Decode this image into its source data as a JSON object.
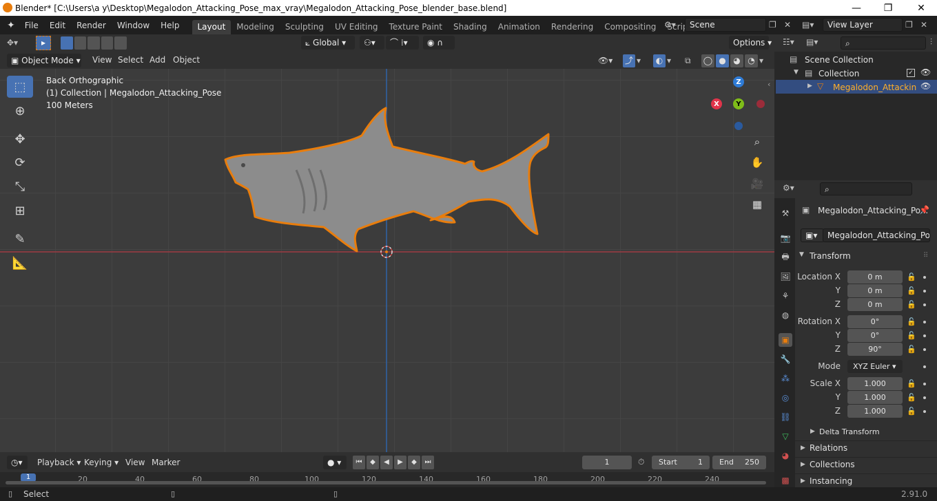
{
  "window": {
    "title": "Blender* [C:\\Users\\a y\\Desktop\\Megalodon_Attacking_Pose_max_vray\\Megalodon_Attacking_Pose_blender_base.blend]"
  },
  "menus": [
    "File",
    "Edit",
    "Render",
    "Window",
    "Help"
  ],
  "workspaces": [
    "Layout",
    "Modeling",
    "Sculpting",
    "UV Editing",
    "Texture Paint",
    "Shading",
    "Animation",
    "Rendering",
    "Compositing",
    "Scripting"
  ],
  "scene": {
    "name": "Scene",
    "view_layer": "View Layer"
  },
  "toolheader": {
    "orientation": "Global",
    "options": "Options"
  },
  "viewport_header": {
    "mode": "Object Mode",
    "menus": [
      "View",
      "Select",
      "Add",
      "Object"
    ]
  },
  "viewport": {
    "view_name": "Back Orthographic",
    "collection_info": "(1) Collection | Megalodon_Attacking_Pose",
    "scale_text": "100 Meters"
  },
  "gizmo": {
    "z": "Z",
    "x": "X",
    "y": "Y"
  },
  "outliner": {
    "scene_collection": "Scene Collection",
    "collection": "Collection",
    "object": "Megalodon_Attackin"
  },
  "properties": {
    "object_name": "Megalodon_Attacking_Po...",
    "object_field": "Megalodon_Attacking_Pose",
    "transform_label": "Transform",
    "labels": {
      "location": "Location X",
      "rotation": "Rotation X",
      "scale": "Scale X",
      "y": "Y",
      "z": "Z",
      "mode": "Mode"
    },
    "location": [
      "0 m",
      "0 m",
      "0 m"
    ],
    "rotation": [
      "0°",
      "0°",
      "90°"
    ],
    "mode_value": "XYZ Euler",
    "scale": [
      "1.000",
      "1.000",
      "1.000"
    ],
    "delta": "Delta Transform",
    "sections": [
      "Relations",
      "Collections",
      "Instancing"
    ]
  },
  "timeline": {
    "menus": [
      "Playback",
      "Keying",
      "View",
      "Marker"
    ],
    "current_frame": "1",
    "start_label": "Start",
    "start": "1",
    "end_label": "End",
    "end": "250",
    "ticks": [
      "1",
      "20",
      "40",
      "60",
      "80",
      "100",
      "120",
      "140",
      "160",
      "180",
      "200",
      "220",
      "240"
    ]
  },
  "status": {
    "left": "Select",
    "version": "2.91.0"
  },
  "colors": {
    "accent": "#4772b3",
    "selection": "#e87d0d",
    "axis_x": "#e0344a",
    "axis_y": "#7fbd19",
    "axis_z": "#2e7bd6"
  }
}
